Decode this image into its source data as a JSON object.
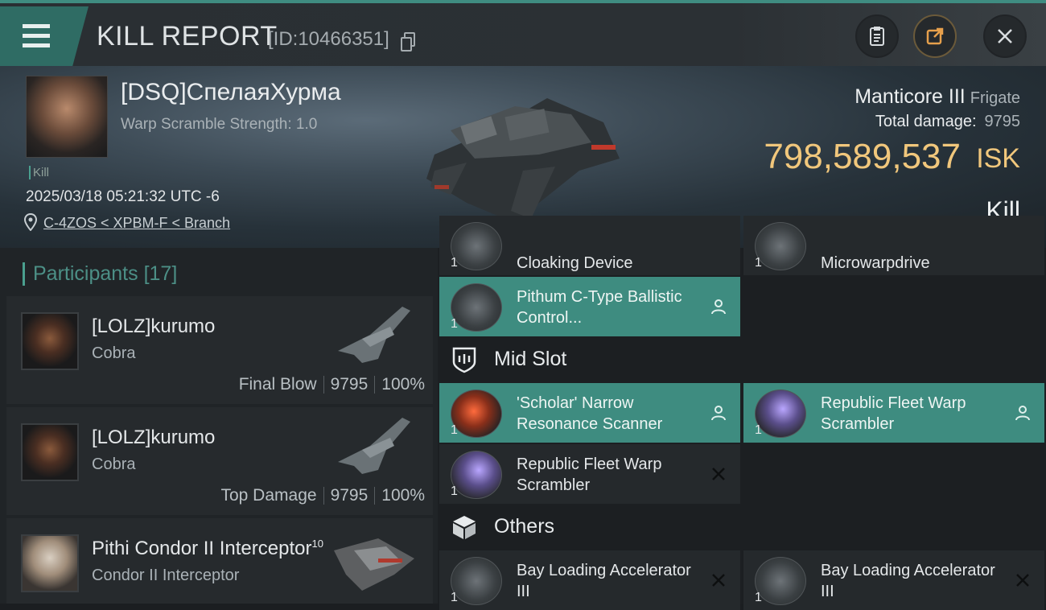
{
  "header": {
    "title": "KILL REPORT",
    "report_id": "[ID:10466351]"
  },
  "victim": {
    "name": "[DSQ]СпелаяХурма",
    "warp_scramble": "Warp Scramble Strength: 1.0",
    "tag": "Kill",
    "datetime": "2025/03/18 05:21:32 UTC -6",
    "location": "C-4ZOS < XPBM-F < Branch",
    "ship": "Manticore III",
    "ship_class": "Frigate",
    "total_damage_label": "Total damage:",
    "total_damage": "9795",
    "isk_value": "798,589,537",
    "isk_unit": "ISK",
    "result": "Kill"
  },
  "participants": {
    "title": "Participants",
    "count": "[17]",
    "rows": [
      {
        "name": "[LOLZ]kurumo",
        "ship": "Cobra",
        "role": "Final Blow",
        "damage": "9795",
        "percent": "100%"
      },
      {
        "name": "[LOLZ]kurumo",
        "ship": "Cobra",
        "role": "Top Damage",
        "damage": "9795",
        "percent": "100%"
      },
      {
        "name": "Pithi Condor II Interceptor",
        "level": "10",
        "ship": "Condor II Interceptor"
      }
    ]
  },
  "modules": {
    "top": [
      {
        "qty": "1",
        "name": "Cloaking Device"
      },
      {
        "qty": "1",
        "name": "Microwarpdrive"
      },
      {
        "qty": "1",
        "name": "Pithum C-Type Ballistic Control..."
      }
    ],
    "mid_slot_label": "Mid Slot",
    "mid": [
      {
        "qty": "1",
        "name": "'Scholar' Narrow Resonance Scanner"
      },
      {
        "qty": "1",
        "name": "Republic Fleet Warp Scrambler"
      },
      {
        "qty": "1",
        "name": "Republic Fleet Warp Scrambler"
      }
    ],
    "others_label": "Others",
    "others": [
      {
        "qty": "1",
        "name": "Bay Loading Accelerator III"
      },
      {
        "qty": "1",
        "name": "Bay Loading Accelerator III"
      }
    ]
  },
  "colors": {
    "accent": "#3e8c80",
    "isk": "#f1c77c",
    "background": "#1b1e21"
  }
}
